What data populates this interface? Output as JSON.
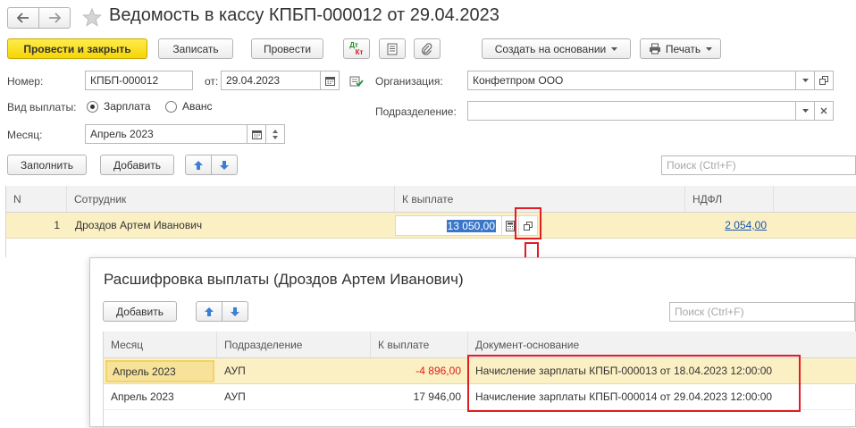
{
  "window": {
    "title": "Ведомость в кассу КПБП-000012 от 29.04.2023"
  },
  "toolbar": {
    "post_close": "Провести и закрыть",
    "save": "Записать",
    "post": "Провести",
    "dtkt_top": "Дт",
    "dtkt_bottom": "Кт",
    "create_based": "Создать на основании",
    "print": "Печать"
  },
  "header": {
    "number_label": "Номер:",
    "number_value": "КПБП-000012",
    "date_label": "от:",
    "date_value": "29.04.2023",
    "org_label": "Организация:",
    "org_value": "Конфетпром ООО",
    "payment_type_label": "Вид выплаты:",
    "payment_salary": "Зарплата",
    "payment_advance": "Аванс",
    "dept_label": "Подразделение:",
    "dept_value": "",
    "month_label": "Месяц:",
    "month_value": "Апрель 2023"
  },
  "table_toolbar": {
    "fill": "Заполнить",
    "add": "Добавить",
    "search_placeholder": "Поиск (Ctrl+F)"
  },
  "main_table": {
    "columns": [
      "N",
      "Сотрудник",
      "К выплате",
      "НДФЛ"
    ],
    "rows": [
      {
        "n": "1",
        "employee": "Дроздов Артем Иванович",
        "amount": "13 050,00",
        "ndfl": "2 054,00"
      }
    ]
  },
  "popup": {
    "title": "Расшифровка выплаты (Дроздов Артем Иванович)",
    "add": "Добавить",
    "search_placeholder": "Поиск (Ctrl+F)",
    "columns": [
      "Месяц",
      "Подразделение",
      "К выплате",
      "Документ-основание"
    ],
    "rows": [
      {
        "month": "Апрель 2023",
        "dept": "АУП",
        "amount": "-4 896,00",
        "doc": "Начисление зарплаты КПБП-000013 от 18.04.2023 12:00:00"
      },
      {
        "month": "Апрель 2023",
        "dept": "АУП",
        "amount": "17 946,00",
        "doc": "Начисление зарплаты КПБП-000014 от 29.04.2023 12:00:00"
      }
    ]
  },
  "colors": {
    "primary_button": "#f5d506",
    "selected_row": "#fbf0c4",
    "highlight_red": "#e01c24",
    "negative_amount": "#e0201a",
    "link": "#1a56b3"
  }
}
